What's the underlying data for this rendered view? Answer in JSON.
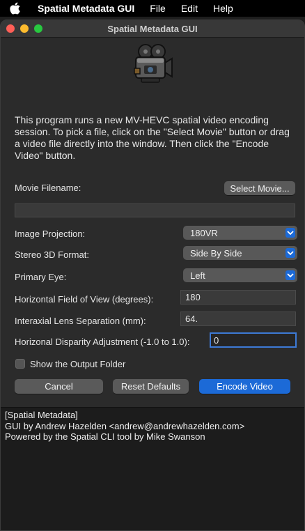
{
  "menubar": {
    "app_name": "Spatial Metadata GUI",
    "items": [
      "File",
      "Edit",
      "Help"
    ]
  },
  "window": {
    "title": "Spatial Metadata GUI"
  },
  "intro_text": "This program runs a new MV-HEVC spatial video encoding session. To pick a file, click on the \"Select Movie\" button or drag a video file directly into the window. Then click the \"Encode Video\" button.",
  "movie": {
    "label": "Movie Filename:",
    "select_label": "Select Movie...",
    "filename_value": ""
  },
  "image_projection": {
    "label": "Image Projection:",
    "value": "180VR"
  },
  "stereo_format": {
    "label": "Stereo 3D Format:",
    "value": "Side By Side"
  },
  "primary_eye": {
    "label": "Primary Eye:",
    "value": "Left"
  },
  "hfov": {
    "label": "Horizontal Field of View (degrees):",
    "value": "180"
  },
  "lens_sep": {
    "label": "Interaxial Lens Separation (mm):",
    "value": "64."
  },
  "disparity": {
    "label": "Horizonal Disparity Adjustment (-1.0 to 1.0):",
    "value": "0"
  },
  "show_output": {
    "label": "Show the Output Folder",
    "checked": false
  },
  "buttons": {
    "cancel": "Cancel",
    "reset": "Reset Defaults",
    "encode": "Encode Video"
  },
  "console": {
    "lines": [
      "[Spatial Metadata]",
      "GUI by Andrew Hazelden <andrew@andrewhazelden.com>",
      "Powered by the Spatial CLI tool by Mike Swanson"
    ]
  },
  "colors": {
    "accent": "#1c6ad7",
    "close": "#ff5f57",
    "minimize": "#febc2e",
    "maximize": "#28c840"
  }
}
